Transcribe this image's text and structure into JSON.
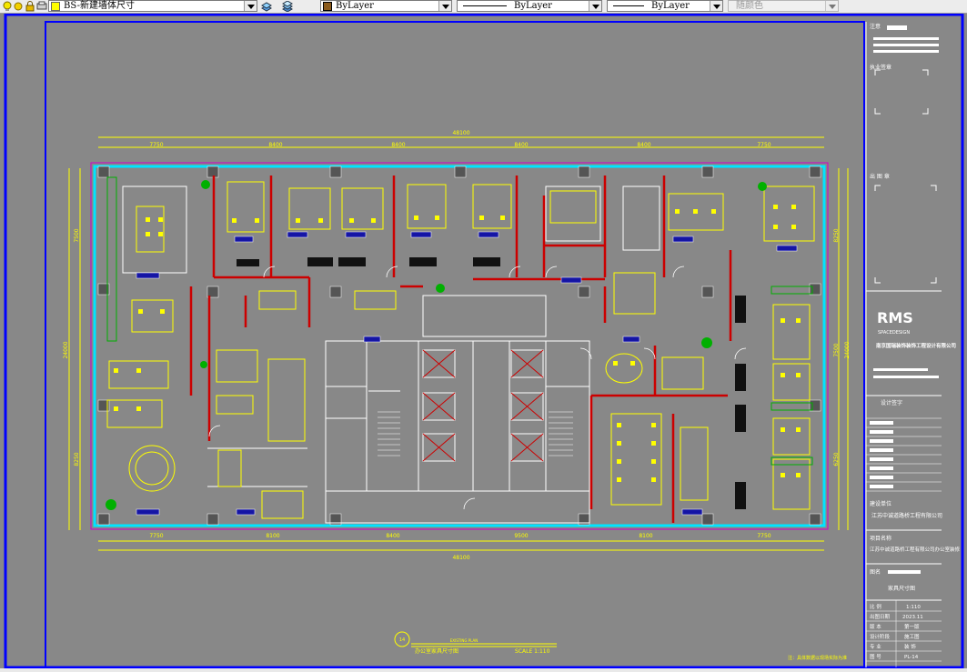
{
  "toolbar": {
    "layer_name": "BS-新建墙体尺寸",
    "color": "ByLayer",
    "linetype": "ByLayer",
    "lineweight": "ByLayer",
    "plot_style": "随颜色"
  },
  "drawing": {
    "top_dims": [
      "7750",
      "8400",
      "8400",
      "8400",
      "8400",
      "7750"
    ],
    "top_total": "48100",
    "bottom_dims": [
      "7750",
      "8100",
      "8400",
      "9500",
      "8100",
      "7750"
    ],
    "bottom_total": "48100",
    "left_dims": [
      "7500",
      "24000",
      "8250"
    ],
    "right_dims": [
      "8250",
      "24000",
      "7500",
      "6250"
    ],
    "plan_label": "EXISTING PLAN",
    "plan_number": "14",
    "plan_title": "办公室家具尺寸图",
    "plan_scale": "SCALE 1:110",
    "footnote": "注：具体数据以现场实际为准"
  },
  "titleblock": {
    "seal_label": "注意",
    "license_label": "执业签章",
    "stamp_label": "出 图 章",
    "logo_text": "RMS",
    "logo_sub": "SPACEDESIGN",
    "company": "南京国瑞装饰装饰工程设计有限公司",
    "design_sign": "设计签字",
    "client_label": "建设单位",
    "client": "江苏中诚道路桥工程有限公司",
    "project_label": "项目名称",
    "project": "江苏中诚道路桥工程有限公司办公室装修",
    "drawing_name_label": "图名",
    "drawing_name": "家具尺寸图",
    "rows": [
      {
        "label": "比 例",
        "value": "1:110"
      },
      {
        "label": "出图日期",
        "value": "2023.11"
      },
      {
        "label": "版 本",
        "value": "第一版"
      },
      {
        "label": "设计阶段",
        "value": "施工图"
      },
      {
        "label": "专 业",
        "value": "装 饰"
      },
      {
        "label": "图 号",
        "value": "PL-14"
      }
    ]
  },
  "colors": {
    "background": "#888888",
    "frame": "#0000ff",
    "wall": "#cc0000",
    "window": "#00e5ff",
    "furniture": "#ffff00",
    "dimension": "#ffff00",
    "partition": "#ffffff",
    "column": "#555555",
    "plant": "#00b000",
    "label_box": "#1515a5"
  }
}
